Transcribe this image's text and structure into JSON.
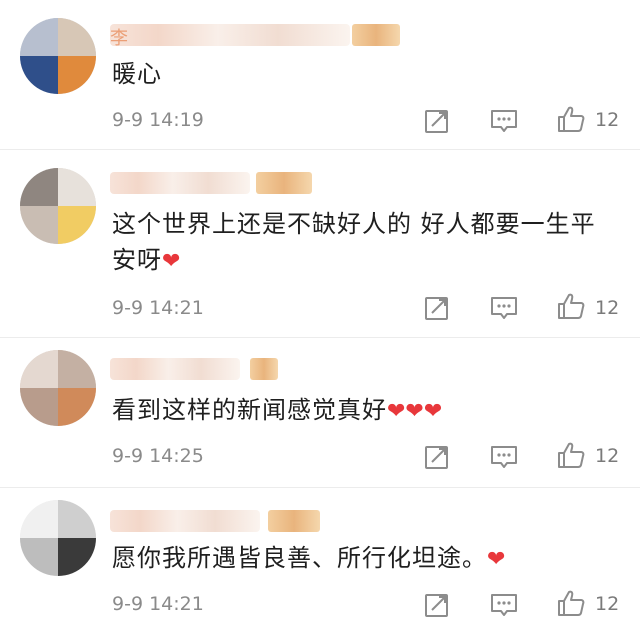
{
  "comments": [
    {
      "text": "暖心",
      "hearts": "",
      "time": "9-9 14:19",
      "likes": "12"
    },
    {
      "text": "这个世界上还是不缺好人的  好人都要一生平安呀",
      "hearts": "❤",
      "time": "9-9 14:21",
      "likes": "12"
    },
    {
      "text": "看到这样的新闻感觉真好",
      "hearts": "❤❤❤",
      "time": "9-9 14:25",
      "likes": "12"
    },
    {
      "text": "愿你我所遇皆良善、所行化坦途。",
      "hearts": "❤",
      "time": "9-9 14:21",
      "likes": "12"
    }
  ],
  "name_first_char": "李",
  "colors": {
    "heart": "#e8373b",
    "meta": "#8a8a8a",
    "icon": "#8c8c8c"
  },
  "icons": [
    "repost-icon",
    "comment-icon",
    "thumbs-up-icon"
  ]
}
